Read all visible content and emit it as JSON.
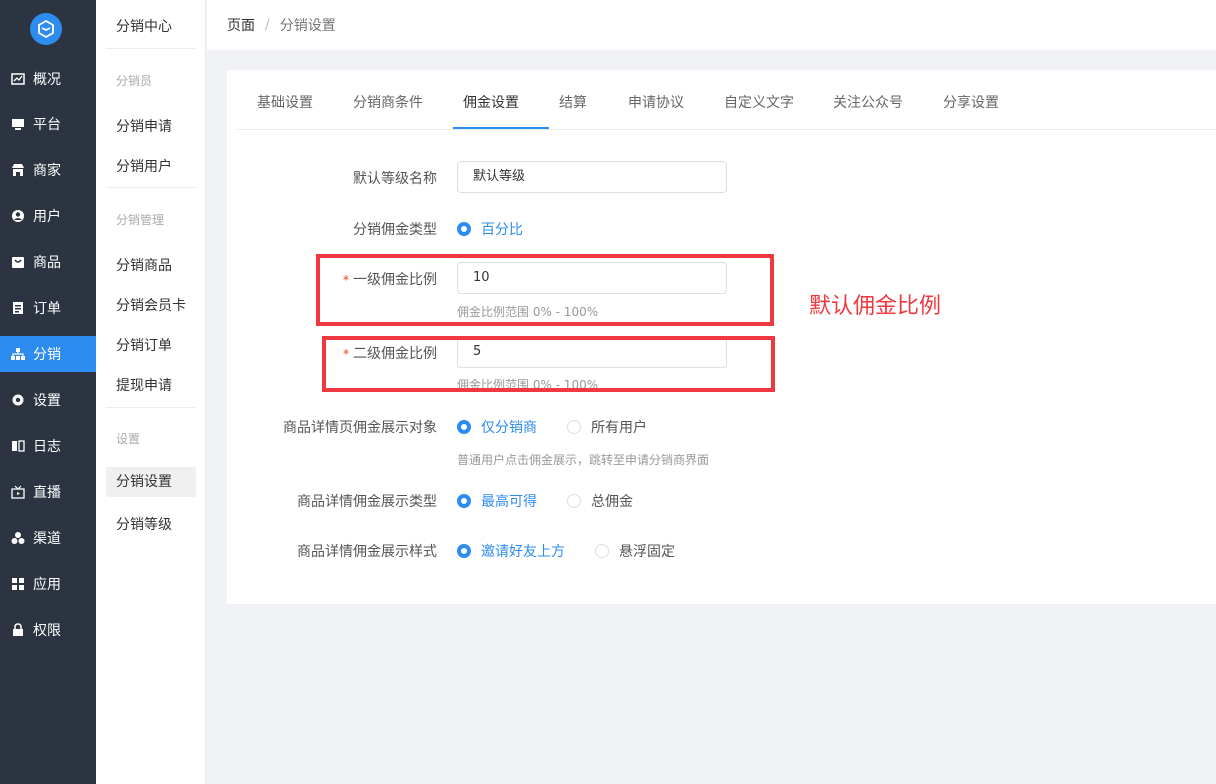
{
  "sidebar": {
    "items": [
      {
        "label": "概况",
        "icon": "chart-icon"
      },
      {
        "label": "平台",
        "icon": "monitor-icon"
      },
      {
        "label": "商家",
        "icon": "store-icon"
      },
      {
        "label": "用户",
        "icon": "user-icon"
      },
      {
        "label": "商品",
        "icon": "bag-icon"
      },
      {
        "label": "订单",
        "icon": "clipboard-icon"
      },
      {
        "label": "分销",
        "icon": "hierarchy-icon"
      },
      {
        "label": "设置",
        "icon": "gear-icon"
      },
      {
        "label": "日志",
        "icon": "book-icon"
      },
      {
        "label": "直播",
        "icon": "tv-icon"
      },
      {
        "label": "渠道",
        "icon": "cluster-icon"
      },
      {
        "label": "应用",
        "icon": "grid-icon"
      },
      {
        "label": "权限",
        "icon": "lock-icon"
      }
    ],
    "active": "分销"
  },
  "submenu": {
    "title": "分销中心",
    "group1": "分销员",
    "item1": "分销申请",
    "item2": "分销用户",
    "group2": "分销管理",
    "item3": "分销商品",
    "item4": "分销会员卡",
    "item5": "分销订单",
    "item6": "提现申请",
    "group3": "设置",
    "item7": "分销设置",
    "item8": "分销等级"
  },
  "breadcrumb": {
    "root": "页面",
    "sep": "/",
    "current": "分销设置"
  },
  "tabs": [
    "基础设置",
    "分销商条件",
    "佣金设置",
    "结算",
    "申请协议",
    "自定义文字",
    "关注公众号",
    "分享设置"
  ],
  "active_tab": "佣金设置",
  "form": {
    "default_level_label": "默认等级名称",
    "default_level_value": "默认等级",
    "commission_type_label": "分销佣金类型",
    "commission_type_option": "百分比",
    "level1_label": "一级佣金比例",
    "level1_value": "10",
    "level1_help": "佣金比例范围 0% - 100%",
    "level2_label": "二级佣金比例",
    "level2_value": "5",
    "level2_help": "佣金比例范围 0% - 100%",
    "required_mark": "*",
    "display_target_label": "商品详情页佣金展示对象",
    "display_target_options": [
      "仅分销商",
      "所有用户"
    ],
    "display_target_help": "普通用户点击佣金展示，跳转至申请分销商界面",
    "display_type_label": "商品详情佣金展示类型",
    "display_type_options": [
      "最高可得",
      "总佣金"
    ],
    "display_style_label": "商品详情佣金展示样式",
    "display_style_options": [
      "邀请好友上方",
      "悬浮固定"
    ]
  },
  "annotation": "默认佣金比例",
  "colors": {
    "sidebar_bg": "#2c3441",
    "accent": "#2d8cf0",
    "highlight": "#f0383f"
  }
}
